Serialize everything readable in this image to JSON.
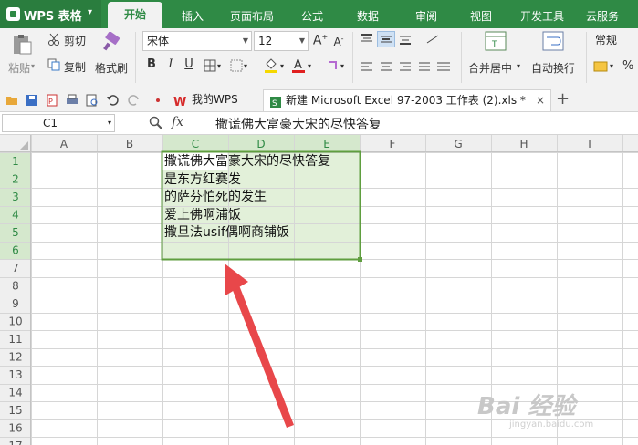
{
  "app": {
    "name": "WPS 表格"
  },
  "menu": [
    "开始",
    "插入",
    "页面布局",
    "公式",
    "数据",
    "审阅",
    "视图",
    "开发工具",
    "云服务"
  ],
  "ribbon": {
    "paste": "粘贴",
    "cut": "剪切",
    "copy": "复制",
    "format_painter": "格式刷",
    "font_name": "宋体",
    "font_size": "12",
    "merge_center": "合并居中",
    "wrap_text": "自动换行",
    "number_format": "常规",
    "percent": "%"
  },
  "tabs": {
    "wps": "我的WPS",
    "file": "新建 Microsoft Excel 97-2003 工作表 (2).xls *"
  },
  "formula_bar": {
    "cell_ref": "C1",
    "fx": "fx",
    "content": "撒谎佛大富豪大宋的尽快答复"
  },
  "sheet": {
    "columns": [
      "A",
      "B",
      "C",
      "D",
      "E",
      "F",
      "G",
      "H",
      "I"
    ],
    "rows": [
      "1",
      "2",
      "3",
      "4",
      "5",
      "6",
      "7",
      "8",
      "9",
      "10",
      "11",
      "12",
      "13",
      "14",
      "15",
      "16",
      "17"
    ],
    "selected_columns": [
      "C",
      "D",
      "E"
    ],
    "selected_rows": [
      "1",
      "2",
      "3",
      "4",
      "5",
      "6"
    ],
    "cells": [
      "撒谎佛大富豪大宋的尽快答复",
      "是东方红赛发",
      "的萨芬怕死的发生",
      "爱上佛啊浦饭",
      "撒旦法usif偶啊商铺饭"
    ]
  },
  "watermark": {
    "main": "Bai 经验",
    "sub": "jingyan.baidu.com"
  },
  "colors": {
    "accent": "#2f8a45",
    "selection_fill": "#e2f0d9",
    "selection_border": "#5f9e3f",
    "arrow": "#e8474a"
  }
}
